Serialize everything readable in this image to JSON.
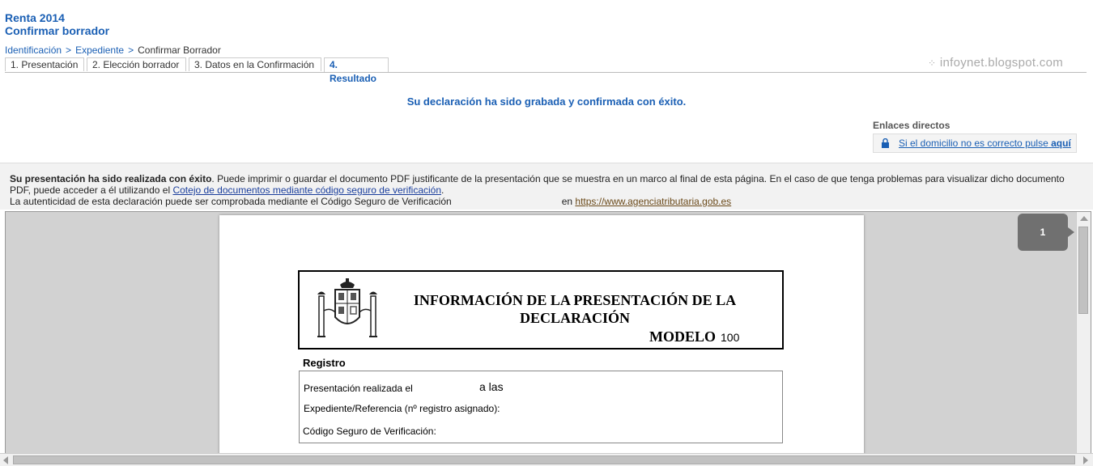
{
  "header": {
    "title_line1": "Renta 2014",
    "title_line2": "Confirmar borrador"
  },
  "breadcrumb": {
    "items": [
      "Identificación",
      "Expediente"
    ],
    "separator": ">",
    "current": "Confirmar Borrador"
  },
  "tabs": [
    {
      "label": "1. Presentación",
      "active": false
    },
    {
      "label": "2. Elección borrador",
      "active": false
    },
    {
      "label": "3. Datos en la Confirmación",
      "active": false
    },
    {
      "label": "4. Resultado",
      "active": true
    }
  ],
  "watermark": "infoynet.blogspot.com",
  "success_message": "Su declaración ha sido grabada y confirmada con éxito.",
  "enlaces": {
    "title": "Enlaces directos",
    "link_text": "Si el domicilio no es correcto pulse",
    "link_bold": "aquí",
    "icon": "lock-icon"
  },
  "info": {
    "bold_intro": "Su presentación ha sido realizada con éxito",
    "text1": ". Puede imprimir o guardar el documento PDF justificante de la presentación que se muestra en un marco al final de esta página. En el caso de que tenga problemas para visualizar dicho documento PDF, puede acceder a él utilizando el ",
    "link1": "Cotejo de documentos mediante código seguro de verificación",
    "text2": ".",
    "text3": "La autenticidad de esta declaración puede ser comprobada mediante el Código Seguro de Verificación",
    "text4": "en",
    "url": "https://www.agenciatributaria.gob.es"
  },
  "pdf": {
    "heading": "INFORMACIÓN DE LA PRESENTACIÓN DE LA DECLARACIÓN",
    "modelo_label": "MODELO",
    "modelo_number": "100",
    "registro_label": "Registro",
    "line1": "Presentación realizada el",
    "line1_b": "a las",
    "line2": "Expediente/Referencia (nº registro asignado):",
    "line3": "Código Seguro de Verificación:",
    "page_indicator": "1"
  },
  "colors": {
    "accent": "#1a5fb4",
    "viewer_bg": "#d2d2d2"
  }
}
